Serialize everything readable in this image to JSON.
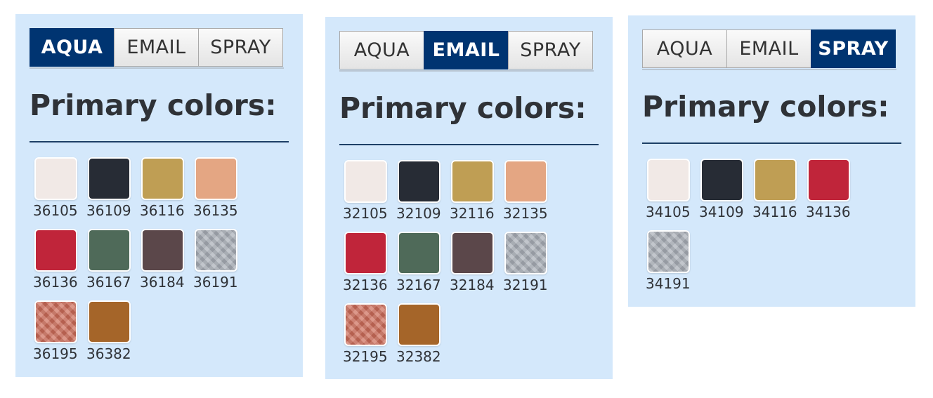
{
  "panels": [
    {
      "tabs": [
        "AQUA",
        "EMAIL",
        "SPRAY"
      ],
      "active_tab": 0,
      "heading": "Primary colors:",
      "swatches": [
        {
          "code": "36105",
          "color": "#f1e9e6",
          "texture": false
        },
        {
          "code": "36109",
          "color": "#272c35",
          "texture": false
        },
        {
          "code": "36116",
          "color": "#bf9e54",
          "texture": false
        },
        {
          "code": "36135",
          "color": "#e4a683",
          "texture": false
        },
        {
          "code": "36136",
          "color": "#c0253a",
          "texture": false
        },
        {
          "code": "36167",
          "color": "#4f6a59",
          "texture": false
        },
        {
          "code": "36184",
          "color": "#5b474a",
          "texture": false
        },
        {
          "code": "36191",
          "color": "#a9afb7",
          "texture": true
        },
        {
          "code": "36195",
          "color": "#cd6d5a",
          "texture": true
        },
        {
          "code": "36382",
          "color": "#a56529",
          "texture": false
        }
      ]
    },
    {
      "tabs": [
        "AQUA",
        "EMAIL",
        "SPRAY"
      ],
      "active_tab": 1,
      "heading": "Primary colors:",
      "swatches": [
        {
          "code": "32105",
          "color": "#f1e9e6",
          "texture": false
        },
        {
          "code": "32109",
          "color": "#272c35",
          "texture": false
        },
        {
          "code": "32116",
          "color": "#bf9e54",
          "texture": false
        },
        {
          "code": "32135",
          "color": "#e4a683",
          "texture": false
        },
        {
          "code": "32136",
          "color": "#c0253a",
          "texture": false
        },
        {
          "code": "32167",
          "color": "#4f6a59",
          "texture": false
        },
        {
          "code": "32184",
          "color": "#5b474a",
          "texture": false
        },
        {
          "code": "32191",
          "color": "#a9afb7",
          "texture": true
        },
        {
          "code": "32195",
          "color": "#cd6d5a",
          "texture": true
        },
        {
          "code": "32382",
          "color": "#a56529",
          "texture": false
        }
      ]
    },
    {
      "tabs": [
        "AQUA",
        "EMAIL",
        "SPRAY"
      ],
      "active_tab": 2,
      "heading": "Primary colors:",
      "swatches": [
        {
          "code": "34105",
          "color": "#f1e9e6",
          "texture": false
        },
        {
          "code": "34109",
          "color": "#272c35",
          "texture": false
        },
        {
          "code": "34116",
          "color": "#bf9e54",
          "texture": false
        },
        {
          "code": "34136",
          "color": "#c0253a",
          "texture": false
        },
        {
          "code": "34191",
          "color": "#a9afb7",
          "texture": true
        }
      ]
    }
  ],
  "colors": {
    "panel_background": "#d4e8fb",
    "active_tab": "#003471",
    "divider": "#1d3f66",
    "text": "#2f3237"
  }
}
